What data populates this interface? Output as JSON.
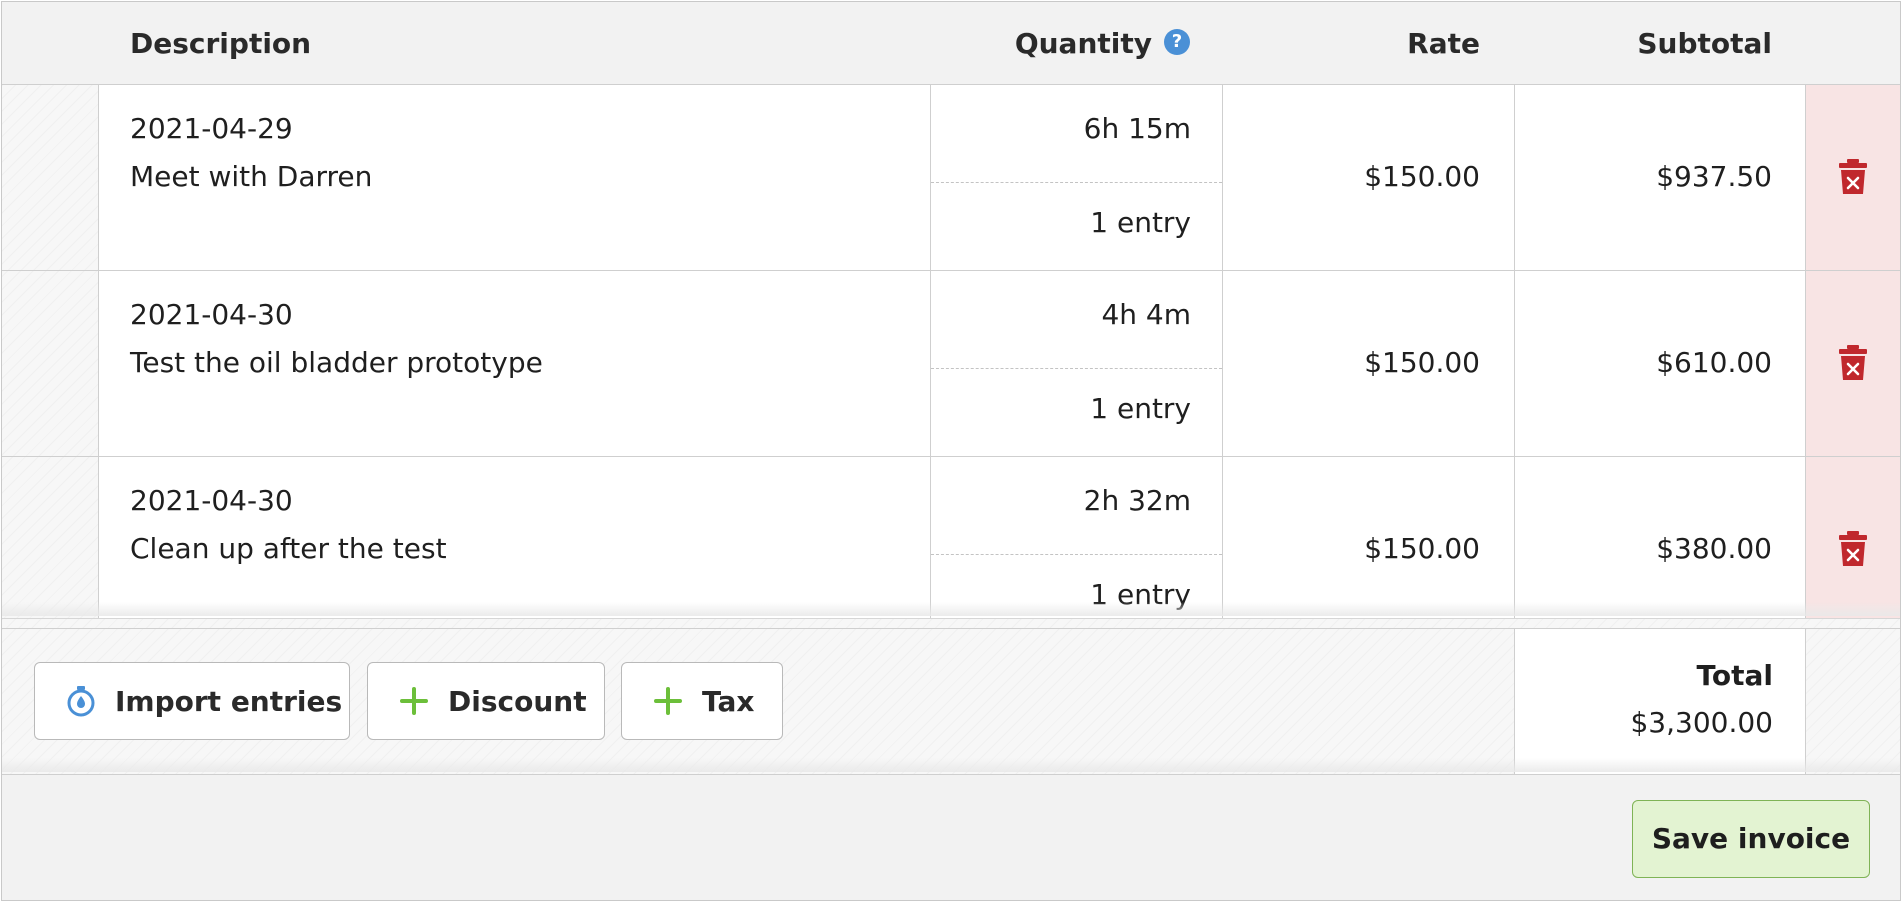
{
  "table": {
    "headers": {
      "description": "Description",
      "quantity": "Quantity",
      "rate": "Rate",
      "subtotal": "Subtotal"
    },
    "rows": [
      {
        "date": "2021-04-29",
        "description": "Meet with Darren",
        "quantity": "6h 15m",
        "entries": "1 entry",
        "rate": "$150.00",
        "subtotal": "$937.50"
      },
      {
        "date": "2021-04-30",
        "description": "Test the oil bladder prototype",
        "quantity": "4h 4m",
        "entries": "1 entry",
        "rate": "$150.00",
        "subtotal": "$610.00"
      },
      {
        "date": "2021-04-30",
        "description": "Clean up after the test",
        "quantity": "2h 32m",
        "entries": "1 entry",
        "rate": "$150.00",
        "subtotal": "$380.00"
      }
    ]
  },
  "actions": {
    "import_label": "Import entries",
    "discount_label": "Discount",
    "tax_label": "Tax"
  },
  "totals": {
    "label": "Total",
    "value": "$3,300.00"
  },
  "footer": {
    "save_label": "Save invoice"
  },
  "icons": {
    "help": "help-icon",
    "delete": "trash-icon",
    "import": "stopwatch-icon",
    "add": "plus-icon"
  },
  "colors": {
    "accent_blue": "#4a90d6",
    "delete_red": "#c0282d",
    "delete_bg": "#f8e4e4",
    "add_green": "#6cbf3a",
    "save_bg": "#e3f3d2",
    "save_border": "#7fb356"
  }
}
